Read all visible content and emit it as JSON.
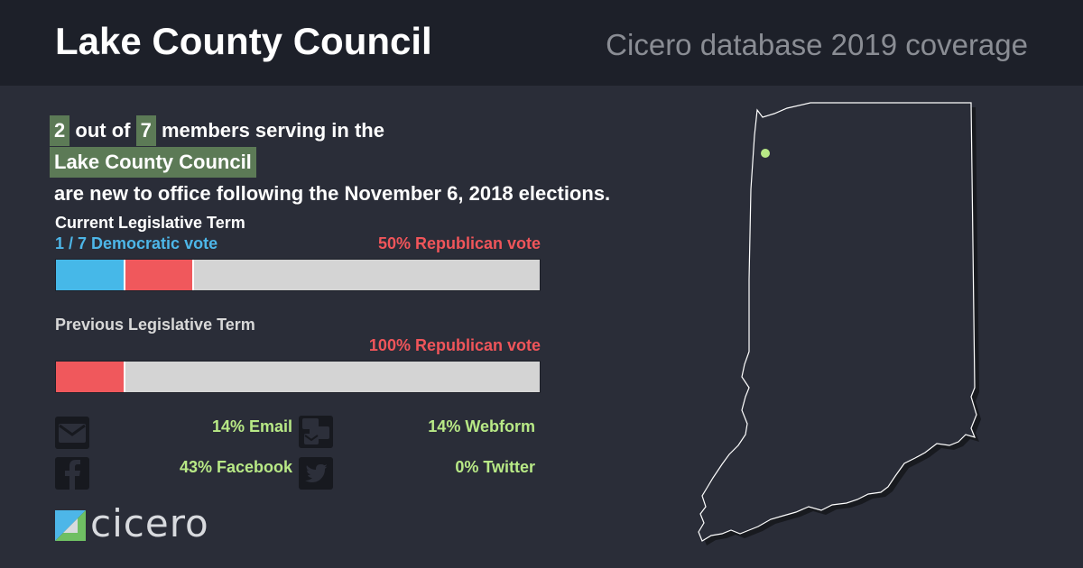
{
  "header": {
    "title": "Lake County Council",
    "subtitle": "Cicero database 2019 coverage"
  },
  "headline": {
    "new_count": "2",
    "out_of_text": "out of",
    "total_count": "7",
    "members_text": "members serving in the",
    "body_name": "Lake County Council",
    "suffix_text": "are new to office following the November 6, 2018 elections."
  },
  "current_term": {
    "label": "Current Legislative Term",
    "dem_text": "1 / 7 Democratic vote",
    "rep_text": "50% Republican vote",
    "dem_fraction": 0.1428,
    "rep_fraction": 0.1428,
    "label_color": "#ffffff"
  },
  "previous_term": {
    "label": "Previous Legislative Term",
    "rep_text": "100% Republican vote",
    "rep_fraction": 0.1428,
    "label_color": "#d8d8d8"
  },
  "contact": [
    {
      "icon": "envelope-icon",
      "text": "14% Email"
    },
    {
      "icon": "webform-icon",
      "text": "14% Webform"
    },
    {
      "icon": "facebook-icon",
      "text": "43% Facebook"
    },
    {
      "icon": "twitter-icon",
      "text": "0% Twitter"
    }
  ],
  "logo": {
    "text": "cicero"
  },
  "colors": {
    "background": "#2a2d38",
    "header": "#1d2029",
    "highlight": "#5c7a56",
    "democratic": "#46b8e8",
    "republican": "#f0585c",
    "contact_text": "#b8e986",
    "map_marker": "#b8e986"
  }
}
